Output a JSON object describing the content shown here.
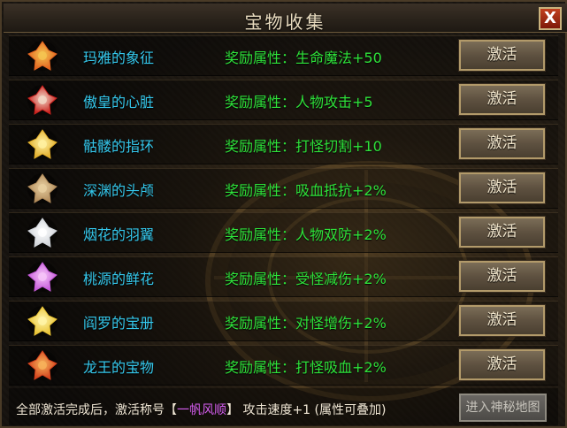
{
  "window": {
    "title": "宝物收集",
    "close_label": "X"
  },
  "items": [
    {
      "name": "玛雅的象征",
      "bonus": "奖励属性：生命魔法+50",
      "button": "激活",
      "icon": "maya-symbol-icon",
      "colors": [
        "#e2631f",
        "#f4c451"
      ]
    },
    {
      "name": "傲皇的心脏",
      "bonus": "奖励属性：人物攻击+5",
      "button": "激活",
      "icon": "heart-icon",
      "colors": [
        "#c8201c",
        "#f1d6c6"
      ]
    },
    {
      "name": "骷髅的指环",
      "bonus": "奖励属性：打怪切割+10",
      "button": "激活",
      "icon": "skull-ring-icon",
      "colors": [
        "#e0ad2a",
        "#fff0a0"
      ]
    },
    {
      "name": "深渊的头颅",
      "bonus": "奖励属性：吸血抵抗+2%",
      "button": "激活",
      "icon": "abyss-skull-icon",
      "colors": [
        "#b08a5a",
        "#e8cfa0"
      ]
    },
    {
      "name": "烟花的羽翼",
      "bonus": "奖励属性：人物双防+2%",
      "button": "激活",
      "icon": "wing-icon",
      "colors": [
        "#cfd3d8",
        "#ffffff"
      ]
    },
    {
      "name": "桃源的鲜花",
      "bonus": "奖励属性：受怪减伤+2%",
      "button": "激活",
      "icon": "flower-icon",
      "colors": [
        "#c45ad8",
        "#f6c3f8"
      ]
    },
    {
      "name": "阎罗的宝册",
      "bonus": "奖励属性：对怪增伤+2%",
      "button": "激活",
      "icon": "book-icon",
      "colors": [
        "#e8c233",
        "#fff4a8"
      ]
    },
    {
      "name": "龙王的宝物",
      "bonus": "奖励属性：打怪吸血+2%",
      "button": "激活",
      "icon": "dragon-treasure-icon",
      "colors": [
        "#d2401c",
        "#f7b25a"
      ]
    }
  ],
  "footer": {
    "text_before": "全部激活完成后，激活称号【",
    "title_name": "一帆风顺",
    "text_after": "】 攻击速度+1 (属性可叠加)",
    "enter_button": "进入神秘地图"
  },
  "colors": {
    "item_name": "#35c8ec",
    "bonus": "#2ee23a",
    "title_highlight": "#d65ef0"
  }
}
